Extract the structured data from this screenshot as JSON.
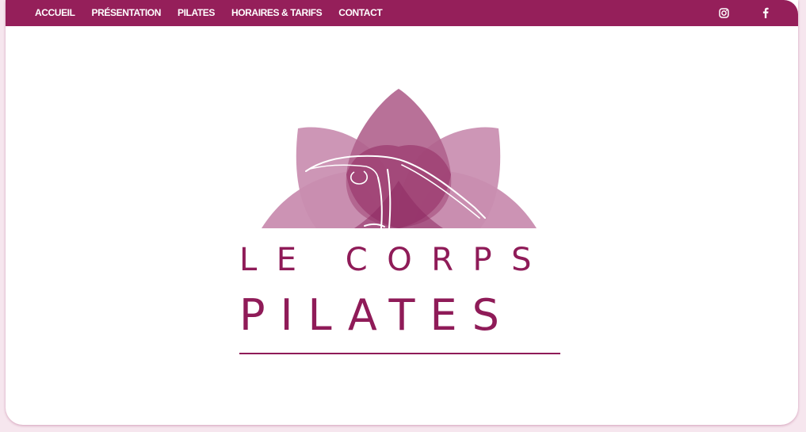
{
  "nav": {
    "items": [
      {
        "label": "ACCUEIL"
      },
      {
        "label": "PRÉSENTATION"
      },
      {
        "label": "PILATES"
      },
      {
        "label": "HORAIRES & TARIFS"
      },
      {
        "label": "CONTACT"
      }
    ],
    "social": [
      {
        "icon": "instagram-icon"
      },
      {
        "icon": "facebook-icon"
      }
    ]
  },
  "logo": {
    "line1": "LE CORPS",
    "line2": "PILATES"
  },
  "colors": {
    "brand": "#951f5a",
    "petal_light": "#c98db0",
    "petal_mid": "#b0628d",
    "petal_dark": "#9c3c70",
    "background": "#ffffff"
  }
}
